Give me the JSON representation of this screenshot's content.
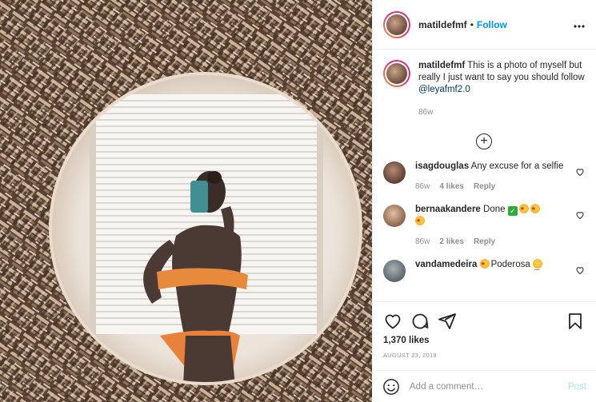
{
  "header": {
    "username": "matildefmf",
    "dot": "•",
    "follow_label": "Follow",
    "more_label": "•••"
  },
  "caption": {
    "username": "matildefmf",
    "text": "This is a photo of myself but really I just want to say you should follow ",
    "mention": "@leyafmf2.0",
    "time": "86w"
  },
  "load_more_label": "+",
  "comments": [
    {
      "username": "isagdouglas",
      "text": "Any excuse for a selfie",
      "time": "86w",
      "likes": "4 likes",
      "reply": "Reply"
    },
    {
      "username": "bernaakandere",
      "text": "Done",
      "time": "86w",
      "likes": "2 likes",
      "reply": "Reply"
    },
    {
      "username": "vandamedeira",
      "text": "Poderosa",
      "time": "",
      "likes": "",
      "reply": ""
    }
  ],
  "likes_label": "1,370 likes",
  "date_label": "AUGUST 23, 2019",
  "add_comment": {
    "placeholder": "Add a comment…",
    "post_label": "Post"
  },
  "colors": {
    "accent": "#0095f6",
    "post_disabled": "#b2dffc",
    "border": "#efefef",
    "muted": "#8e8e8e"
  },
  "icons": [
    "heart-icon",
    "comment-icon",
    "share-icon",
    "bookmark-icon",
    "smiley-icon",
    "plus-circle-icon",
    "more-icon"
  ]
}
